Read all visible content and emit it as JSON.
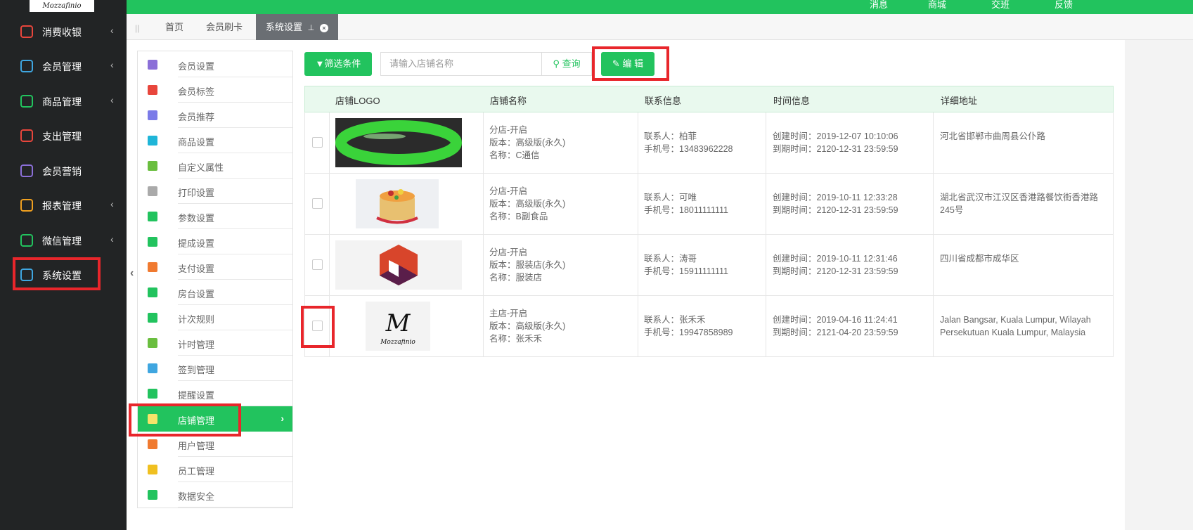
{
  "top_nav": [
    "消息",
    "商城",
    "交班",
    "反馈"
  ],
  "brand": "Mozzafinio",
  "sidebar": {
    "items": [
      {
        "label": "消费收银",
        "icon": "cashier-icon",
        "color": "#e8463c",
        "chevron": "‹"
      },
      {
        "label": "会员管理",
        "icon": "member-icon",
        "color": "#3fa6e0",
        "chevron": "‹"
      },
      {
        "label": "商品管理",
        "icon": "goods-icon",
        "color": "#22c35e",
        "chevron": "‹"
      },
      {
        "label": "支出管理",
        "icon": "expense-icon",
        "color": "#e8463c",
        "chevron": ""
      },
      {
        "label": "会员营销",
        "icon": "gift-icon",
        "color": "#8b6fd8",
        "chevron": ""
      },
      {
        "label": "报表管理",
        "icon": "report-icon",
        "color": "#f0a020",
        "chevron": "‹"
      },
      {
        "label": "微信管理",
        "icon": "wechat-icon",
        "color": "#22c35e",
        "chevron": "‹"
      },
      {
        "label": "系统设置",
        "icon": "gear-icon",
        "color": "#3fa6e0",
        "chevron": ""
      }
    ]
  },
  "tabs": {
    "items": [
      "首页",
      "会员刷卡"
    ],
    "active": "系统设置"
  },
  "menu": {
    "items": [
      {
        "label": "会员设置",
        "color": "#8b6fd8"
      },
      {
        "label": "会员标签",
        "color": "#e8463c"
      },
      {
        "label": "会员推荐",
        "color": "#7b7be8"
      },
      {
        "label": "商品设置",
        "color": "#1fb5d8"
      },
      {
        "label": "自定义属性",
        "color": "#6abe3f"
      },
      {
        "label": "打印设置",
        "color": "#aaaaaa"
      },
      {
        "label": "参数设置",
        "color": "#22c35e"
      },
      {
        "label": "提成设置",
        "color": "#22c35e"
      },
      {
        "label": "支付设置",
        "color": "#f07a30"
      },
      {
        "label": "房台设置",
        "color": "#22c35e"
      },
      {
        "label": "计次规则",
        "color": "#22c35e"
      },
      {
        "label": "计时管理",
        "color": "#6abe3f"
      },
      {
        "label": "签到管理",
        "color": "#3fa6e0"
      },
      {
        "label": "提醒设置",
        "color": "#22c35e"
      },
      {
        "label": "店铺管理",
        "color": "#f5e36a"
      },
      {
        "label": "用户管理",
        "color": "#f07a30"
      },
      {
        "label": "员工管理",
        "color": "#f0c020"
      },
      {
        "label": "数据安全",
        "color": "#22c35e"
      }
    ],
    "active_index": 14,
    "arrow": "›"
  },
  "toolbar": {
    "filter_label": "筛选条件",
    "search_placeholder": "请输入店铺名称",
    "query_label": "查询",
    "edit_label": "编 辑"
  },
  "table": {
    "headers": [
      "店铺LOGO",
      "店铺名称",
      "联系信息",
      "时间信息",
      "详细地址"
    ],
    "rows": [
      {
        "logo": "jade-bangle",
        "name1": "分店-开启",
        "name2": "版本：高级版(永久)",
        "name3": "名称：C通信",
        "contact1": "联系人：柏菲",
        "contact2": "手机号：13483962228",
        "time1": "创建时间：2019-12-07 10:10:06",
        "time2": "到期时间：2120-12-31 23:59:59",
        "address": "河北省邯郸市曲周县公仆路"
      },
      {
        "logo": "cake",
        "name1": "分店-开启",
        "name2": "版本：高级版(永久)",
        "name3": "名称：B副食品",
        "contact1": "联系人：可唯",
        "contact2": "手机号：18011111111",
        "time1": "创建时间：2019-10-11 12:33:28",
        "time2": "到期时间：2120-12-31 23:59:59",
        "address": "湖北省武汉市江汉区香港路餐饮街香港路245号"
      },
      {
        "logo": "hexagon-logo",
        "name1": "分店-开启",
        "name2": "版本：服装店(永久)",
        "name3": "名称：服装店",
        "contact1": "联系人：涛哥",
        "contact2": "手机号：15911111111",
        "time1": "创建时间：2019-10-11 12:31:46",
        "time2": "到期时间：2120-12-31 23:59:59",
        "address": "四川省成都市成华区"
      },
      {
        "logo": "mozzafinio-logo",
        "logo_text": "M",
        "logo_caption": "Mozzafinio",
        "name1": "主店-开启",
        "name2": "版本：高级版(永久)",
        "name3": "名称：张禾禾",
        "contact1": "联系人：张禾禾",
        "contact2": "手机号：19947858989",
        "time1": "创建时间：2019-04-16 11:24:41",
        "time2": "到期时间：2121-04-20 23:59:59",
        "address": "Jalan Bangsar, Kuala Lumpur, Wilayah Persekutuan Kuala Lumpur, Malaysia"
      }
    ]
  },
  "colors": {
    "brand_green": "#22c35e",
    "highlight_red": "#e8262b",
    "sidebar_bg": "#222425"
  }
}
